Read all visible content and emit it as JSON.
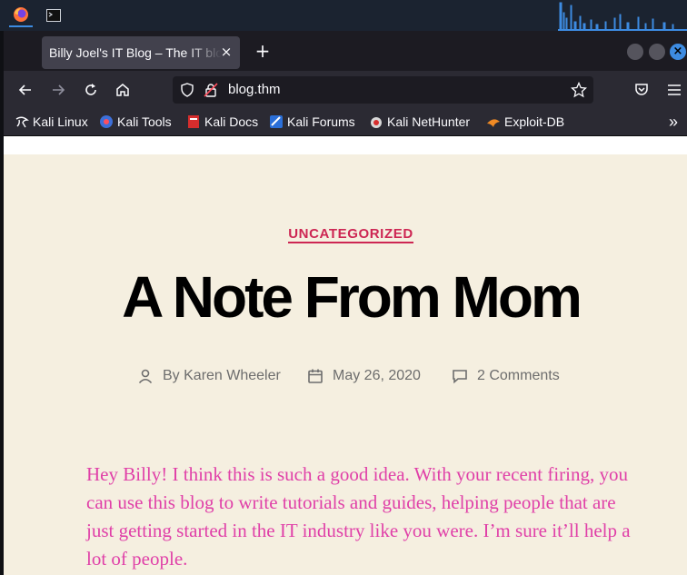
{
  "taskbar": {
    "apps": [
      {
        "icon": "firefox-icon",
        "active": true
      },
      {
        "icon": "terminal-icon",
        "active": false
      }
    ],
    "graph_color": "#3d8be1"
  },
  "browser": {
    "tab": {
      "title": "Billy Joel's IT Blog – The IT blog",
      "close": "×"
    },
    "new_tab": "+",
    "url": "blog.thm",
    "bookmarks": [
      {
        "label": "Kali Linux",
        "icon": "kali-dragon-icon"
      },
      {
        "label": "Kali Tools",
        "icon": "kali-tools-icon"
      },
      {
        "label": "Kali Docs",
        "icon": "kali-docs-icon"
      },
      {
        "label": "Kali Forums",
        "icon": "kali-forums-icon"
      },
      {
        "label": "Kali NetHunter",
        "icon": "kali-nethunter-icon"
      },
      {
        "label": "Exploit-DB",
        "icon": "exploit-db-icon"
      }
    ],
    "overflow": "»"
  },
  "post": {
    "category": "UNCATEGORIZED",
    "title": "A Note From Mom",
    "author": "By Karen Wheeler",
    "date": "May 26, 2020",
    "comments": "2 Comments",
    "body": "Hey Billy!  I think this is such a good idea.  With your recent firing, you can use this blog to write tutorials and guides, helping people that are just getting started in the IT industry like you were.  I’m sure it’ll help a lot of people."
  },
  "colors": {
    "accent": "#cd2653",
    "page_bg": "#f5efe0",
    "body_text": "#e040a8"
  }
}
